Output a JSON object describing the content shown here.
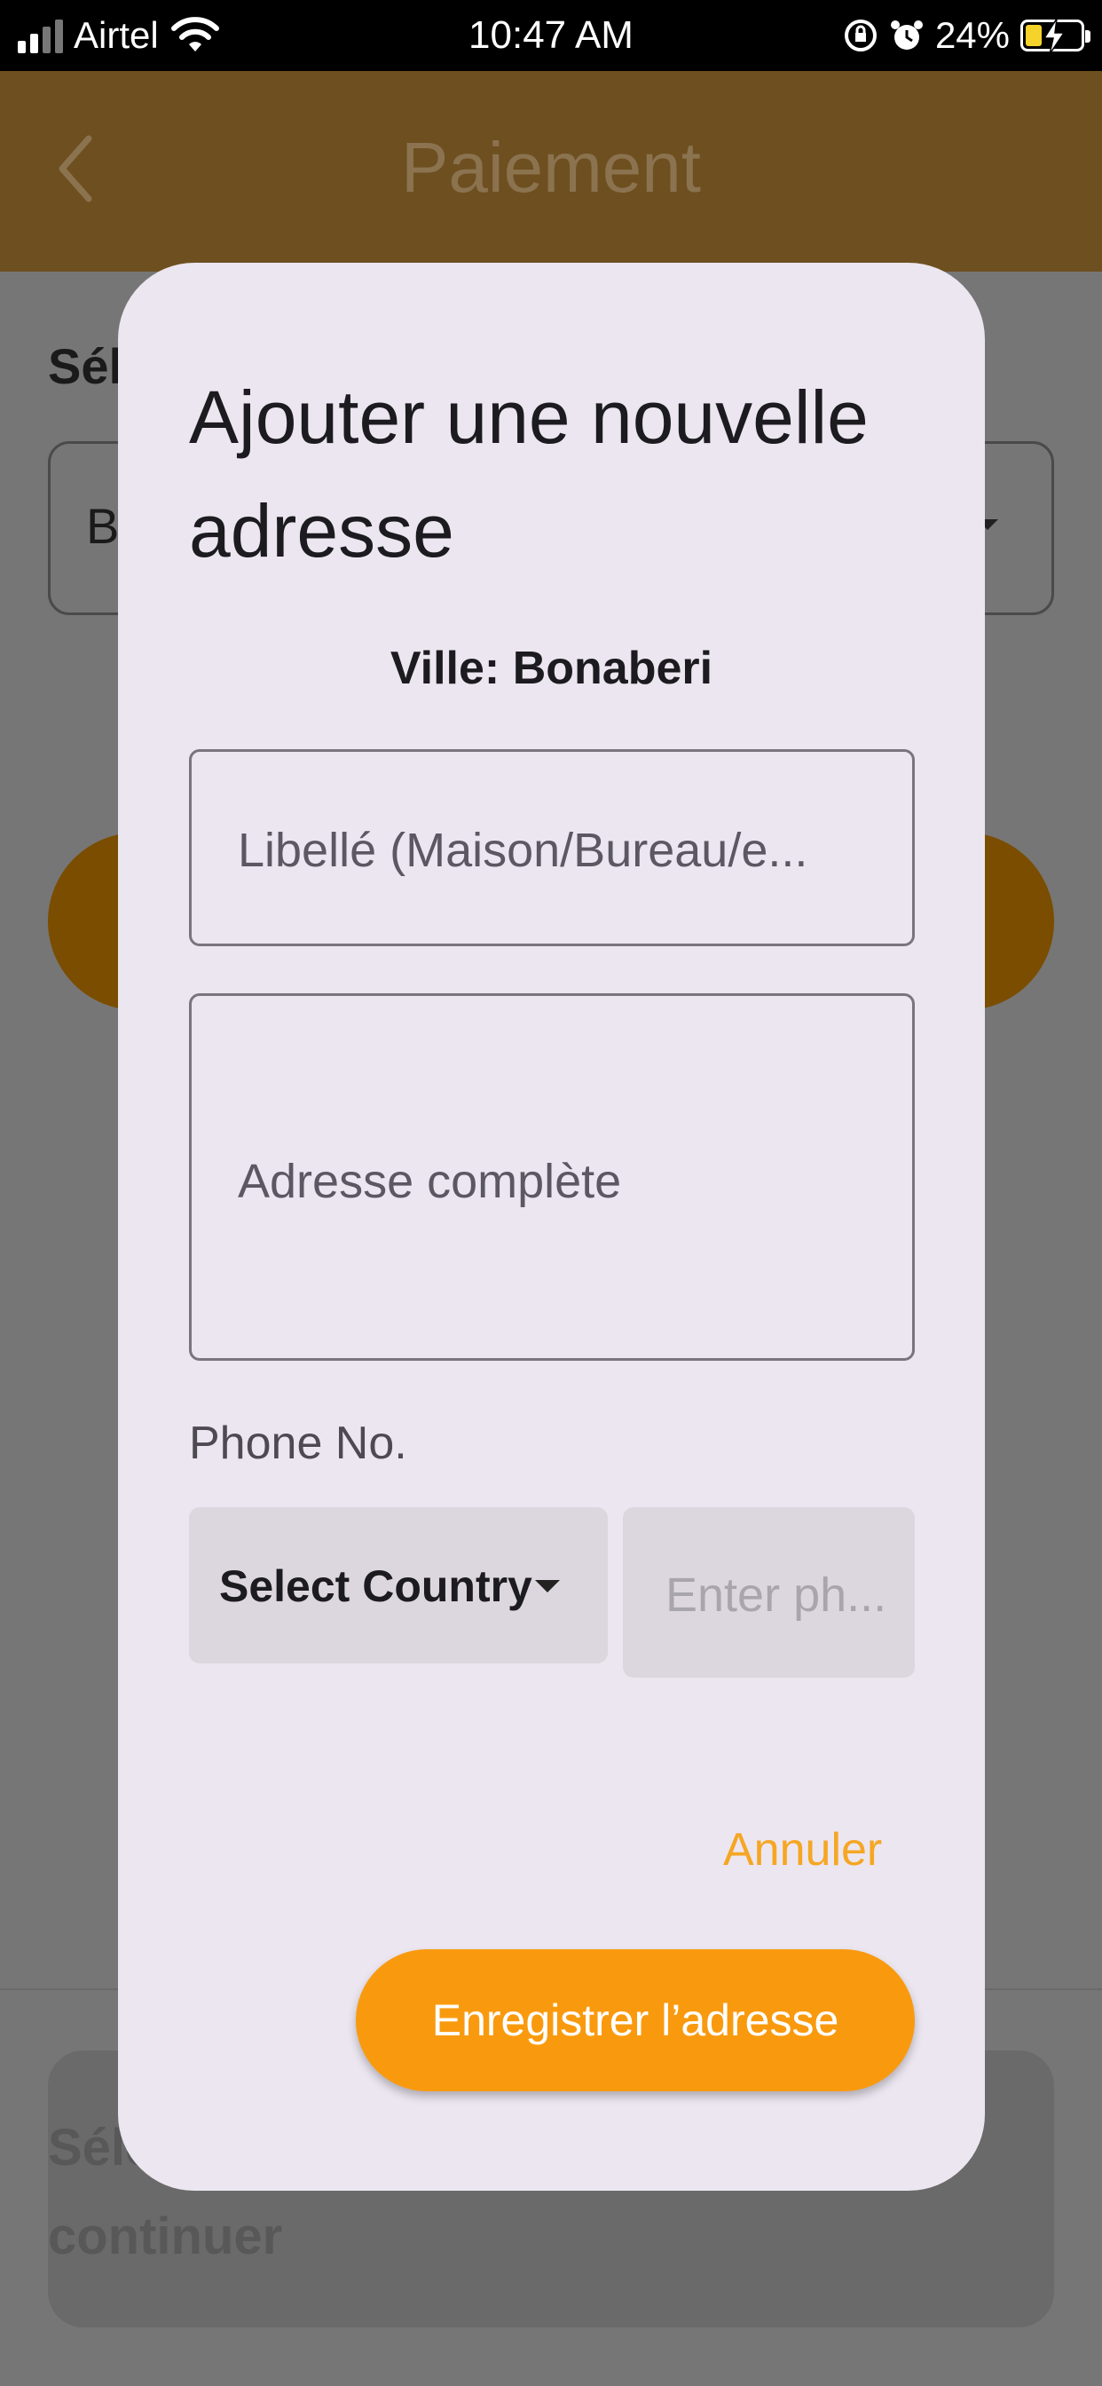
{
  "status_bar": {
    "carrier": "Airtel",
    "time": "10:47 AM",
    "battery_percent": "24%",
    "icons": [
      "signal-icon",
      "wifi-icon",
      "orientation-lock-icon",
      "alarm-icon",
      "battery-charging-icon"
    ]
  },
  "app_bar": {
    "title": "Paiement",
    "back_icon": "chevron-left-icon",
    "color": "#6e4f20"
  },
  "background_page": {
    "section_label": "Sél",
    "select_value": "B",
    "bottom_card_text": [
      "Sélé",
      "continuer"
    ]
  },
  "dialog": {
    "title": "Ajouter une nouvelle adresse",
    "city": "Ville: Bonaberi",
    "label_field": {
      "placeholder": "Libellé (Maison/Bureau/e..."
    },
    "address_field": {
      "placeholder": "Adresse complète"
    },
    "phone_label": "Phone No.",
    "country_select": {
      "value": "Select Country"
    },
    "phone_input": {
      "placeholder": "Enter ph..."
    },
    "cancel_label": "Annuler",
    "save_label": "Enregistrer l’adresse",
    "accent_color": "#f99a0e"
  }
}
